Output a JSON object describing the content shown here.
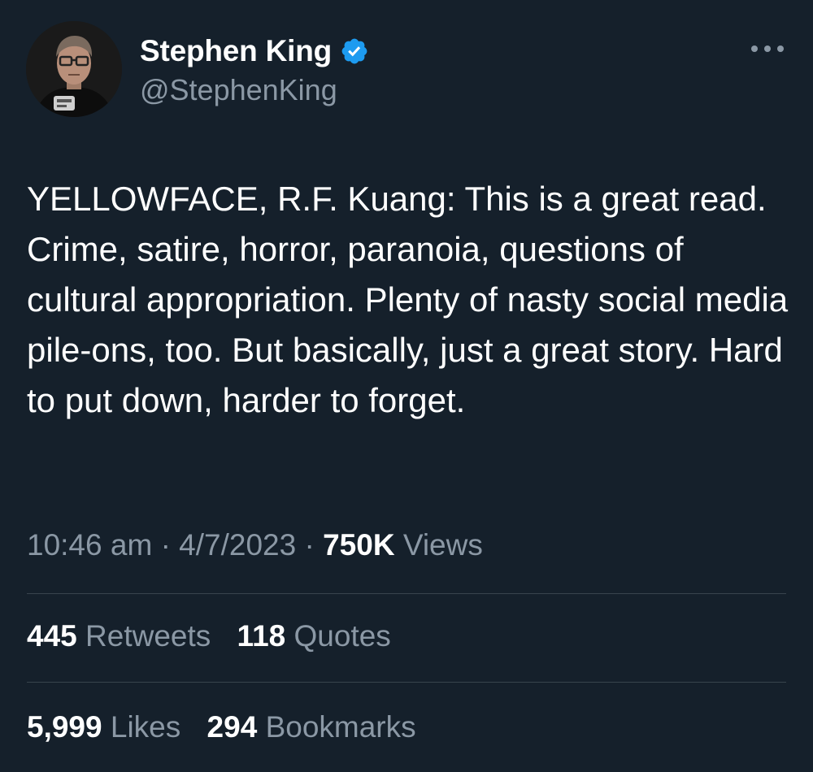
{
  "author": {
    "display_name": "Stephen King",
    "handle": "@StephenKing",
    "verified_icon": "verified-badge-icon"
  },
  "tweet": {
    "text": "YELLOWFACE, R.F. Kuang: This is a great read. Crime, satire, horror, paranoia, questions of cultural appropriation. Plenty of nasty social media pile-ons, too. But basically, just a great story. Hard to put down, harder to forget."
  },
  "meta": {
    "time": "10:46 am",
    "separator": "·",
    "date": "4/7/2023",
    "views_count": "750K",
    "views_label": "Views"
  },
  "stats_row1": {
    "retweets_count": "445",
    "retweets_label": "Retweets",
    "quotes_count": "118",
    "quotes_label": "Quotes"
  },
  "stats_row2": {
    "likes_count": "5,999",
    "likes_label": "Likes",
    "bookmarks_count": "294",
    "bookmarks_label": "Bookmarks"
  },
  "icons": {
    "more": "more-options-icon",
    "verified": "verified-badge-icon"
  },
  "colors": {
    "background": "#15202b",
    "text_primary": "#ffffff",
    "text_secondary": "#8b98a5",
    "divider": "#38444d",
    "verified_blue": "#1d9bf0"
  }
}
